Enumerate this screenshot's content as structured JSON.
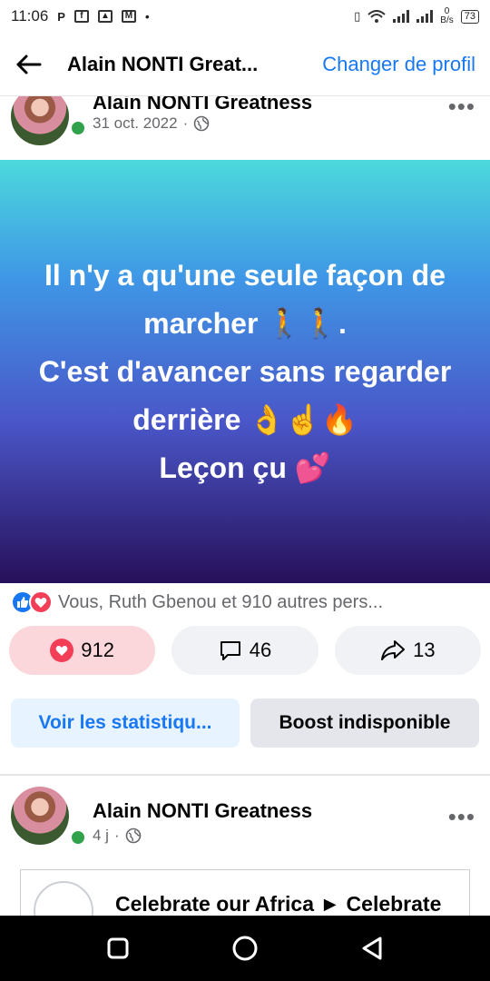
{
  "status_bar": {
    "time": "11:06",
    "left_icons": [
      "parking-icon",
      "facebook-icon",
      "app-icon",
      "mail-icon",
      "dot-icon"
    ],
    "data_speed_value": "0",
    "data_speed_unit": "B/s",
    "battery": "73"
  },
  "header": {
    "title": "Alain NONTI Great...",
    "action": "Changer de profil"
  },
  "post1": {
    "author": "Alain NONTI Greatness",
    "date": "31 oct. 2022",
    "separator": "·",
    "background_colors": [
      "#4cd9dc",
      "#3f97e6",
      "#4a56c8",
      "#27105a"
    ],
    "text_lines": [
      "Il n'y a qu'une seule façon de",
      "marcher 🚶🚶.",
      "C'est d'avancer sans regarder",
      "derrière 👌☝️🔥",
      "Leçon çu 💕"
    ],
    "reaction_summary": "Vous, Ruth Gbenou et 910 autres pers...",
    "reactions_count": "912",
    "comments_count": "46",
    "shares_count": "13",
    "stats_button": "Voir les statistiqu...",
    "boost_button": "Boost indisponible"
  },
  "post2": {
    "author": "Alain NONTI Greatness",
    "date": "4 j",
    "separator": "·",
    "link_title": "Celebrate our Africa ► Celebrate"
  },
  "colors": {
    "accent": "#1877f2",
    "love": "#f33e58",
    "online": "#31a24c"
  }
}
